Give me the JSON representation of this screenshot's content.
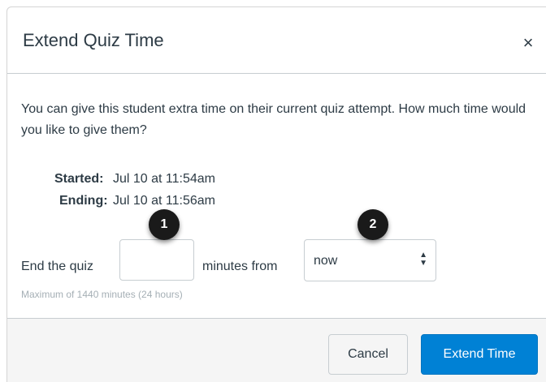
{
  "dialog": {
    "title": "Extend Quiz Time",
    "close_glyph": "×"
  },
  "body": {
    "intro": "You can give this student extra time on their current quiz attempt. How much time would you like to give them?",
    "started_label": "Started:",
    "started_value": "Jul 10 at 11:54am",
    "ending_label": "Ending:",
    "ending_value": "Jul 10 at 11:56am",
    "end_quiz_label": "End the quiz",
    "minutes_value": "",
    "minutes_from_label": "minutes from",
    "from_select_value": "now",
    "hint": "Maximum of 1440 minutes (24 hours)"
  },
  "footer": {
    "cancel_label": "Cancel",
    "extend_label": "Extend Time"
  },
  "callouts": {
    "one": "1",
    "two": "2"
  },
  "colors": {
    "primary_button": "#0081d5",
    "text": "#2d3b45",
    "hint_text": "#a5afb5",
    "footer_bg": "#f5f5f5",
    "callout_bg": "#1a1a1a"
  }
}
